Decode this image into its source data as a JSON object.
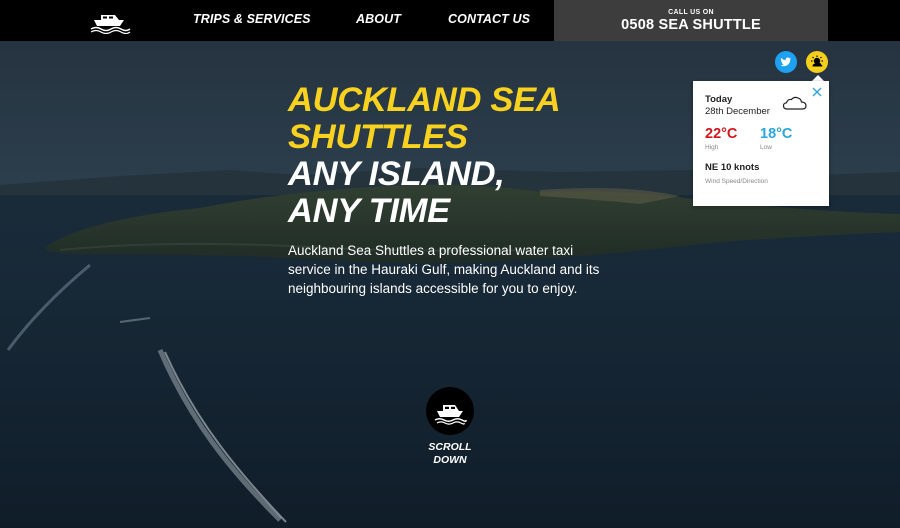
{
  "nav": {
    "logo_icon": "boat-logo-icon",
    "links": [
      "TRIPS & SERVICES",
      "ABOUT",
      "CONTACT US"
    ],
    "call_label": "CALL US ON",
    "call_number": "0508 SEA SHUTTLE"
  },
  "social": {
    "twitter_icon": "twitter-icon",
    "weather_icon": "weather-sun-cloud-icon"
  },
  "weather": {
    "day": "Today",
    "date": "28th December",
    "condition_icon": "cloud-icon",
    "high": "22°C",
    "high_label": "High",
    "low": "18°C",
    "low_label": "Low",
    "wind": "NE 10 knots",
    "wind_label": "Wind Speed/Direction"
  },
  "hero": {
    "title_lines": [
      "AUCKLAND SEA",
      "SHUTTLES",
      "ANY ISLAND,",
      "ANY TIME"
    ],
    "description": "Auckland Sea Shuttles a professional water taxi service in the Hauraki Gulf, making Auckland and its neighbouring islands accessible for you to enjoy."
  },
  "scroll": {
    "label_line1": "SCROLL",
    "label_line2": "DOWN"
  },
  "colors": {
    "accent_yellow": "#f8d21f",
    "nav_black": "#000000",
    "call_box": "#3d3d3d",
    "temp_high": "#d4161b",
    "temp_low": "#2aa6dd",
    "twitter_blue": "#1da1f2"
  }
}
